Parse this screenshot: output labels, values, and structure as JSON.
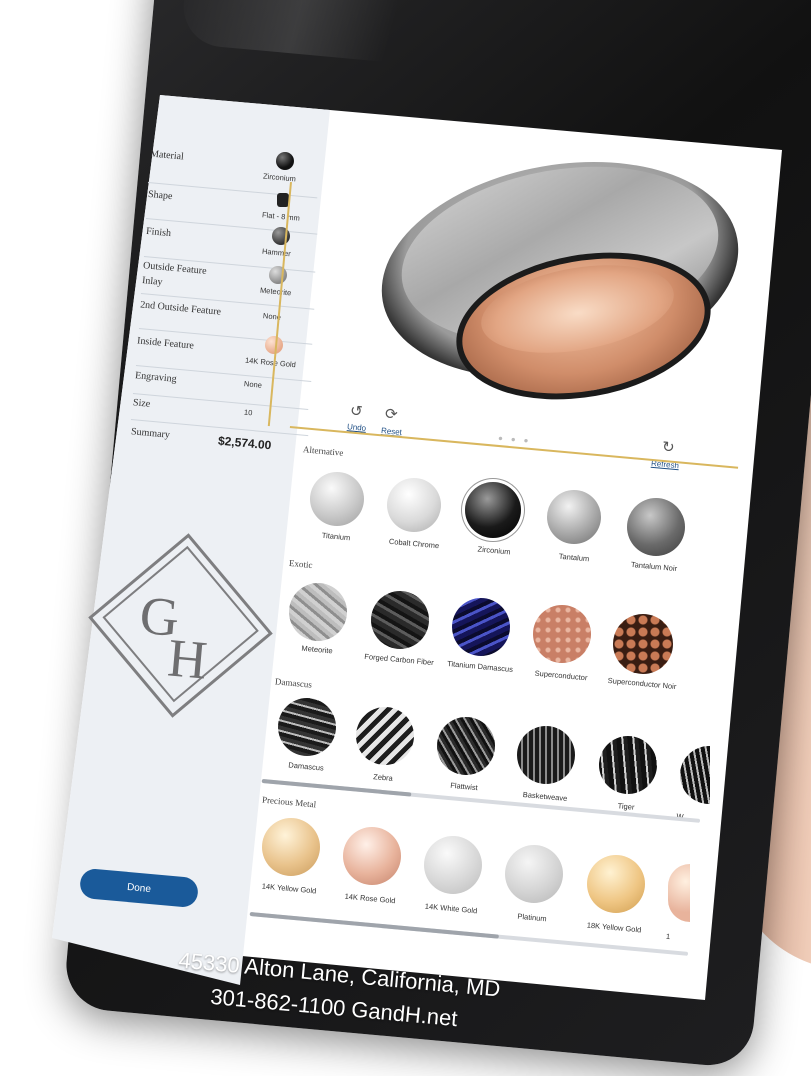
{
  "sidebar": {
    "rows": [
      {
        "label": "Material",
        "value": "Zirconium"
      },
      {
        "label": "Shape",
        "value": "Flat - 8 mm"
      },
      {
        "label": "Finish",
        "value": "Hammer"
      },
      {
        "label": "Outside Feature",
        "label2": "Inlay",
        "value": "Meteorite"
      },
      {
        "label": "2nd Outside Feature",
        "value": "None"
      },
      {
        "label": "Inside Feature",
        "value": "14K Rose Gold"
      },
      {
        "label": "Engraving",
        "value": "None"
      },
      {
        "label": "Size",
        "value": "10"
      },
      {
        "label": "Summary",
        "value": "$2,574.00"
      }
    ],
    "done_label": "Done",
    "logo_text": "GH"
  },
  "preview": {
    "undo_label": "Undo",
    "reset_label": "Reset",
    "refresh_label": "Refresh"
  },
  "sections": [
    {
      "title": "Alternative",
      "items": [
        "Titanium",
        "Cobalt Chrome",
        "Zirconium",
        "Tantalum",
        "Tantalum Noir"
      ]
    },
    {
      "title": "Exotic",
      "items": [
        "Meteorite",
        "Forged Carbon Fiber",
        "Titanium Damascus",
        "Superconductor",
        "Superconductor Noir"
      ]
    },
    {
      "title": "Damascus",
      "items": [
        "Damascus",
        "Zebra",
        "Flattwist",
        "Basketweave",
        "Tiger",
        "W"
      ]
    },
    {
      "title": "Precious Metal",
      "items": [
        "14K Yellow Gold",
        "14K Rose Gold",
        "14K White Gold",
        "Platinum",
        "18K Yellow Gold",
        "1"
      ]
    }
  ],
  "footer": {
    "address": "45330 Alton Lane, California, MD",
    "contact": "301-862-1100 GandH.net"
  },
  "colors": {
    "accent_blue": "#1a5a9a",
    "gold_rule": "#d9b75e",
    "panel_bg": "#edf0f4"
  }
}
